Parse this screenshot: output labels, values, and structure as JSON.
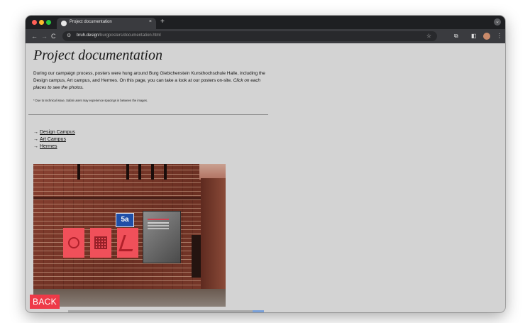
{
  "browser": {
    "tab_title": "Project documentation",
    "tab_close": "×",
    "new_tab": "+",
    "url_host": "bruh.design",
    "url_path": "/burgposters/documentation.html",
    "nav": {
      "back": "←",
      "forward": "→",
      "reload": "C"
    },
    "icons": {
      "site_info": "site-info-icon",
      "star": "star-icon",
      "extensions": "extensions-icon",
      "sidebar": "sidebar-icon",
      "menu": "kebab-menu-icon"
    }
  },
  "page": {
    "title": "Project documentation",
    "intro": "During our campaign process, posters were hung around Burg Giebichenstein Kunsthochschule Halle, including the Design campus, Art campus, and Hermes. On this page, you can take a look at our posters on-site.",
    "intro_emphasis": "Click on each places to see the photos.",
    "note": "* Due to technical issue, Safari users may experience spacings in between the images.",
    "places": [
      {
        "arrow": "→",
        "label": "Design Campus"
      },
      {
        "arrow": "→",
        "label": "Art Campus"
      },
      {
        "arrow": "→",
        "label": "Hermes"
      }
    ],
    "photo": {
      "sign_number": "5a"
    },
    "back_label": "BACK"
  },
  "colors": {
    "page_background": "#d3d3d3",
    "back_button": "#ee3a48",
    "poster_red": "#f0505a"
  }
}
